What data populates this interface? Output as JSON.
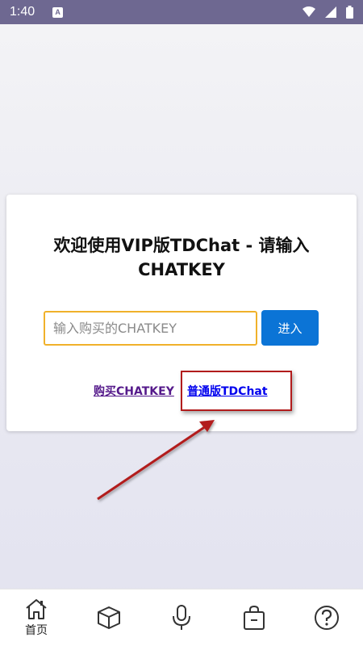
{
  "status_bar": {
    "time": "1:40",
    "notification_badge": "A",
    "icons": [
      "wifi-icon",
      "signal-icon",
      "battery-icon"
    ]
  },
  "card": {
    "title_line1": "欢迎使用VIP版TDChat - 请输入",
    "title_line2": "CHATKEY",
    "input": {
      "placeholder": "输入购买的CHATKEY",
      "value": ""
    },
    "enter_button": "进入",
    "link_buy": "购买CHATKEY",
    "link_normal": "普通版TDChat"
  },
  "annotation": {
    "highlight_color": "#b21c1c"
  },
  "bottom_nav": {
    "items": [
      {
        "icon": "home-icon",
        "label": "首页",
        "active": true
      },
      {
        "icon": "cube-icon",
        "label": ""
      },
      {
        "icon": "microphone-icon",
        "label": ""
      },
      {
        "icon": "shopping-bag-icon",
        "label": ""
      },
      {
        "icon": "help-icon",
        "label": ""
      }
    ]
  },
  "colors": {
    "status_bar": "#6e6891",
    "input_border": "#f0b12a",
    "primary_button": "#0b74d6",
    "visited_link": "#551a8b",
    "link": "#0000ee"
  }
}
